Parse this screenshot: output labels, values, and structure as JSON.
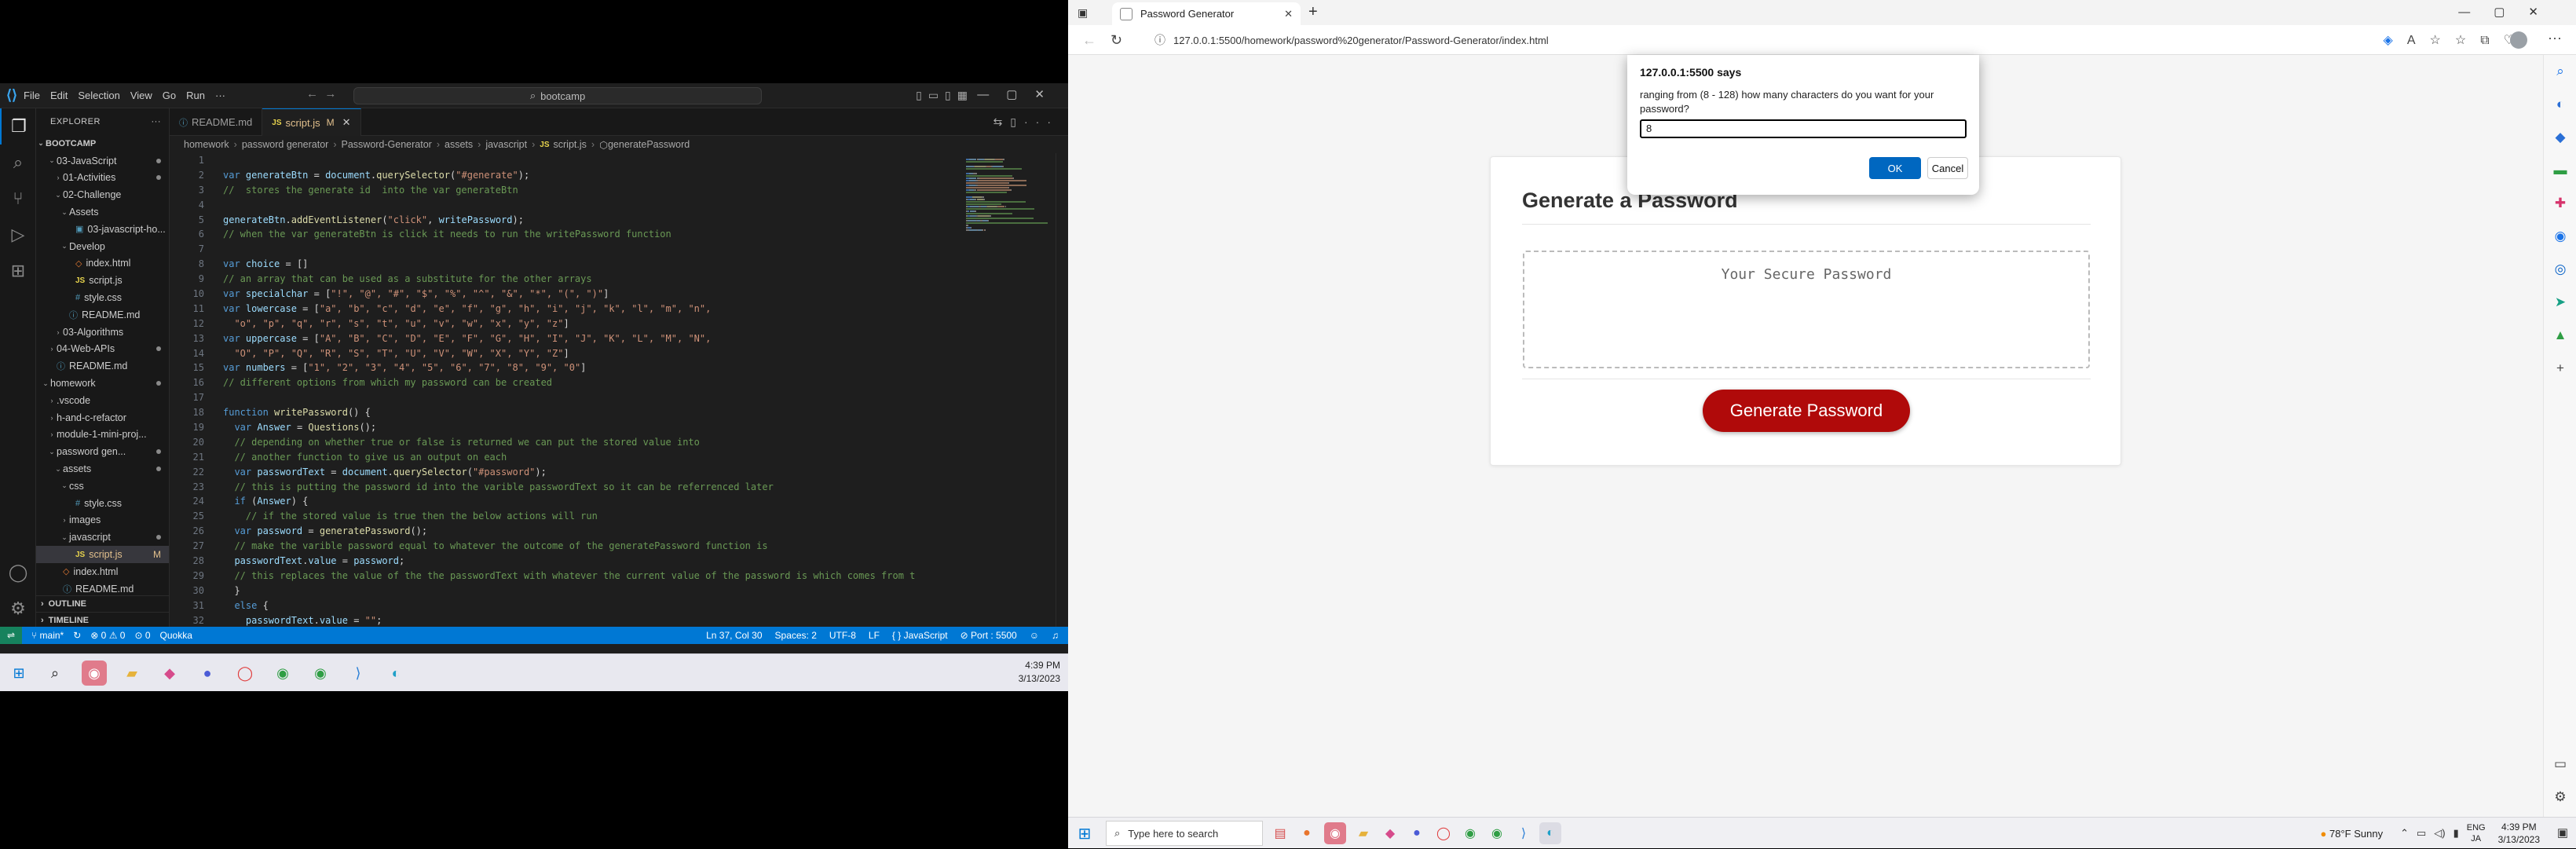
{
  "vscode": {
    "menu": [
      "File",
      "Edit",
      "Selection",
      "View",
      "Go",
      "Run"
    ],
    "more": "···",
    "command_center": "bootcamp",
    "explorer_title": "EXPLORER",
    "root": "BOOTCAMP",
    "tree": [
      {
        "label": "03-JavaScript",
        "indent": 1,
        "type": "folder-open",
        "dot": true
      },
      {
        "label": "01-Activities",
        "indent": 2,
        "type": "folder",
        "dot": true
      },
      {
        "label": "02-Challenge",
        "indent": 2,
        "type": "folder-open",
        "dot": false
      },
      {
        "label": "Assets",
        "indent": 3,
        "type": "folder-open",
        "dot": false
      },
      {
        "label": "03-javascript-ho...",
        "indent": 4,
        "type": "image",
        "dot": false
      },
      {
        "label": "Develop",
        "indent": 3,
        "type": "folder-open",
        "dot": false
      },
      {
        "label": "index.html",
        "indent": 4,
        "type": "html",
        "dot": false
      },
      {
        "label": "script.js",
        "indent": 4,
        "type": "js",
        "dot": false
      },
      {
        "label": "style.css",
        "indent": 4,
        "type": "css",
        "dot": false
      },
      {
        "label": "README.md",
        "indent": 3,
        "type": "md",
        "dot": false
      },
      {
        "label": "03-Algorithms",
        "indent": 2,
        "type": "folder",
        "dot": false
      },
      {
        "label": "04-Web-APIs",
        "indent": 1,
        "type": "folder",
        "dot": true
      },
      {
        "label": "README.md",
        "indent": 1,
        "type": "md",
        "dot": false
      },
      {
        "label": "homework",
        "indent": 0,
        "type": "folder-open",
        "dot": true
      },
      {
        "label": ".vscode",
        "indent": 1,
        "type": "folder",
        "dot": false
      },
      {
        "label": "h-and-c-refactor",
        "indent": 1,
        "type": "folder",
        "dot": false
      },
      {
        "label": "module-1-mini-proj...",
        "indent": 1,
        "type": "folder",
        "dot": false
      },
      {
        "label": "password gen...",
        "indent": 1,
        "type": "folder-open",
        "dot": true
      },
      {
        "label": "assets",
        "indent": 2,
        "type": "folder-open",
        "dot": true
      },
      {
        "label": "css",
        "indent": 3,
        "type": "folder-open",
        "dot": false
      },
      {
        "label": "style.css",
        "indent": 4,
        "type": "css",
        "dot": false
      },
      {
        "label": "images",
        "indent": 3,
        "type": "folder",
        "dot": false
      },
      {
        "label": "javascript",
        "indent": 3,
        "type": "folder-open",
        "dot": true
      },
      {
        "label": "script.js",
        "indent": 4,
        "type": "js",
        "dot": false,
        "selected": true,
        "modified": "M"
      },
      {
        "label": "index.html",
        "indent": 2,
        "type": "html",
        "dot": false
      },
      {
        "label": "README.md",
        "indent": 2,
        "type": "md",
        "dot": false
      }
    ],
    "outline": "OUTLINE",
    "timeline": "TIMELINE",
    "tabs": [
      {
        "label": "README.md",
        "active": false,
        "icon": "md",
        "badge": ""
      },
      {
        "label": "script.js",
        "active": true,
        "icon": "js",
        "badge": "M"
      }
    ],
    "breadcrumb": [
      "homework",
      "password generator",
      "Password-Generator",
      "assets",
      "javascript",
      "script.js",
      "generatePassword"
    ],
    "current_line": 37,
    "code": [
      {
        "n": 1,
        "t": []
      },
      {
        "n": 2,
        "t": [
          [
            "kw",
            "var "
          ],
          [
            "vr",
            "generateBtn"
          ],
          [
            "p",
            " = "
          ],
          [
            "vr",
            "document"
          ],
          [
            "p",
            "."
          ],
          [
            "fn",
            "querySelector"
          ],
          [
            "p",
            "("
          ],
          [
            "str",
            "\"#generate\""
          ],
          [
            "p",
            ");"
          ]
        ]
      },
      {
        "n": 3,
        "t": [
          [
            "cmt",
            "//  stores the generate id  into the var generateBtn"
          ]
        ]
      },
      {
        "n": 4,
        "t": []
      },
      {
        "n": 5,
        "t": [
          [
            "vr",
            "generateBtn"
          ],
          [
            "p",
            "."
          ],
          [
            "fn",
            "addEventListener"
          ],
          [
            "p",
            "("
          ],
          [
            "str",
            "\"click\""
          ],
          [
            "p",
            ", "
          ],
          [
            "vr",
            "writePassword"
          ],
          [
            "p",
            ");"
          ]
        ]
      },
      {
        "n": 6,
        "t": [
          [
            "cmt",
            "// when the var generateBtn is click it needs to run the writePassword function"
          ]
        ]
      },
      {
        "n": 7,
        "t": []
      },
      {
        "n": 8,
        "t": [
          [
            "kw",
            "var "
          ],
          [
            "vr",
            "choice"
          ],
          [
            "p",
            " = []"
          ]
        ]
      },
      {
        "n": 9,
        "t": [
          [
            "cmt",
            "// an array that can be used as a substitute for the other arrays"
          ]
        ]
      },
      {
        "n": 10,
        "t": [
          [
            "kw",
            "var "
          ],
          [
            "vr",
            "specialchar"
          ],
          [
            "p",
            " = ["
          ],
          [
            "str",
            "\"!\", \"@\", \"#\", \"$\", \"%\", \"^\", \"&\", \"*\", \"(\", \")\""
          ],
          [
            "p",
            "]"
          ]
        ]
      },
      {
        "n": 11,
        "t": [
          [
            "kw",
            "var "
          ],
          [
            "vr",
            "lowercase"
          ],
          [
            "p",
            " = ["
          ],
          [
            "str",
            "\"a\", \"b\", \"c\", \"d\", \"e\", \"f\", \"g\", \"h\", \"i\", \"j\", \"k\", \"l\", \"m\", \"n\","
          ]
        ]
      },
      {
        "n": 12,
        "t": [
          [
            "str",
            "  \"o\", \"p\", \"q\", \"r\", \"s\", \"t\", \"u\", \"v\", \"w\", \"x\", \"y\", \"z\""
          ],
          [
            "p",
            "]"
          ]
        ]
      },
      {
        "n": 13,
        "t": [
          [
            "kw",
            "var "
          ],
          [
            "vr",
            "uppercase"
          ],
          [
            "p",
            " = ["
          ],
          [
            "str",
            "\"A\", \"B\", \"C\", \"D\", \"E\", \"F\", \"G\", \"H\", \"I\", \"J\", \"K\", \"L\", \"M\", \"N\","
          ]
        ]
      },
      {
        "n": 14,
        "t": [
          [
            "str",
            "  \"O\", \"P\", \"Q\", \"R\", \"S\", \"T\", \"U\", \"V\", \"W\", \"X\", \"Y\", \"Z\""
          ],
          [
            "p",
            "]"
          ]
        ]
      },
      {
        "n": 15,
        "t": [
          [
            "kw",
            "var "
          ],
          [
            "vr",
            "numbers"
          ],
          [
            "p",
            " = ["
          ],
          [
            "str",
            "\"1\", \"2\", \"3\", \"4\", \"5\", \"6\", \"7\", \"8\", \"9\", \"0\""
          ],
          [
            "p",
            "]"
          ]
        ]
      },
      {
        "n": 16,
        "t": [
          [
            "cmt",
            "// different options from which my password can be created"
          ]
        ]
      },
      {
        "n": 17,
        "t": []
      },
      {
        "n": 18,
        "t": [
          [
            "kw",
            "function "
          ],
          [
            "fn",
            "writePassword"
          ],
          [
            "p",
            "() {"
          ]
        ]
      },
      {
        "n": 19,
        "t": [
          [
            "p",
            "  "
          ],
          [
            "kw",
            "var "
          ],
          [
            "vr",
            "Answer"
          ],
          [
            "p",
            " = "
          ],
          [
            "fn",
            "Questions"
          ],
          [
            "p",
            "();"
          ]
        ]
      },
      {
        "n": 20,
        "t": [
          [
            "cmt",
            "  // depending on whether true or false is returned we can put the stored value into"
          ]
        ]
      },
      {
        "n": 21,
        "t": [
          [
            "cmt",
            "  // another function to give us an output on each"
          ]
        ]
      },
      {
        "n": 22,
        "t": [
          [
            "p",
            "  "
          ],
          [
            "kw",
            "var "
          ],
          [
            "vr",
            "passwordText"
          ],
          [
            "p",
            " = "
          ],
          [
            "vr",
            "document"
          ],
          [
            "p",
            "."
          ],
          [
            "fn",
            "querySelector"
          ],
          [
            "p",
            "("
          ],
          [
            "str",
            "\"#password\""
          ],
          [
            "p",
            ");"
          ]
        ]
      },
      {
        "n": 23,
        "t": [
          [
            "cmt",
            "  // this is putting the password id into the varible passwordText so it can be referrenced later"
          ]
        ]
      },
      {
        "n": 24,
        "t": [
          [
            "p",
            "  "
          ],
          [
            "kw",
            "if "
          ],
          [
            "p",
            "("
          ],
          [
            "vr",
            "Answer"
          ],
          [
            "p",
            ") {"
          ]
        ]
      },
      {
        "n": 25,
        "t": [
          [
            "cmt",
            "    // if the stored value is true then the below actions will run"
          ]
        ]
      },
      {
        "n": 26,
        "t": [
          [
            "p",
            "  "
          ],
          [
            "kw",
            "var "
          ],
          [
            "vr",
            "password"
          ],
          [
            "p",
            " = "
          ],
          [
            "fn",
            "generatePassword"
          ],
          [
            "p",
            "();"
          ]
        ]
      },
      {
        "n": 27,
        "t": [
          [
            "cmt",
            "  // make the varible password equal to whatever the outcome of the generatePassword function is"
          ]
        ]
      },
      {
        "n": 28,
        "t": [
          [
            "p",
            "  "
          ],
          [
            "vr",
            "passwordText"
          ],
          [
            "p",
            "."
          ],
          [
            "vr",
            "value"
          ],
          [
            "p",
            " = "
          ],
          [
            "vr",
            "password"
          ],
          [
            "p",
            ";"
          ]
        ]
      },
      {
        "n": 29,
        "t": [
          [
            "cmt",
            "  // this replaces the value of the the passwordText with whatever the current value of the password is which comes from t"
          ]
        ]
      },
      {
        "n": 30,
        "t": [
          [
            "p",
            "  }"
          ]
        ]
      },
      {
        "n": 31,
        "t": [
          [
            "p",
            "  "
          ],
          [
            "kw",
            "else "
          ],
          [
            "p",
            "{"
          ]
        ]
      },
      {
        "n": 32,
        "t": [
          [
            "p",
            "    "
          ],
          [
            "vr",
            "passwordText"
          ],
          [
            "p",
            "."
          ],
          [
            "vr",
            "value"
          ],
          [
            "p",
            " = "
          ],
          [
            "str",
            "\"\""
          ],
          [
            "p",
            ";"
          ]
        ]
      }
    ],
    "status": {
      "branch": "main*",
      "problems": "⊗ 0 ⚠ 0",
      "ports": "0",
      "quokka": "Quokka",
      "position": "Ln 37, Col 30",
      "spaces": "Spaces: 2",
      "encoding": "UTF-8",
      "eol": "LF",
      "language": "JavaScript",
      "port": "Port : 5500"
    }
  },
  "taskbar_left": {
    "time": "4:39 PM",
    "date": "3/13/2023"
  },
  "edge": {
    "tab_title": "Password Generator",
    "url": "127.0.0.1:5500/homework/password%20generator/Password-Generator/index.html",
    "page": {
      "heading": "Generate a Password",
      "placeholder": "Your Secure Password",
      "button": "Generate Password"
    },
    "dialog": {
      "title": "127.0.0.1:5500 says",
      "message": "ranging from (8 - 128) how many characters do you want for your password?",
      "input_value": "8",
      "ok": "OK",
      "cancel": "Cancel"
    }
  },
  "taskbar_right": {
    "search_placeholder": "Type here to search",
    "weather": "78°F  Sunny",
    "lang_top": "ENG",
    "lang_bottom": "JA",
    "time": "4:39 PM",
    "date": "3/13/2023"
  },
  "colors": {
    "vscode_accent": "#0078d4",
    "generate_button": "#b00a0a",
    "dialog_ok": "#0067c0"
  }
}
